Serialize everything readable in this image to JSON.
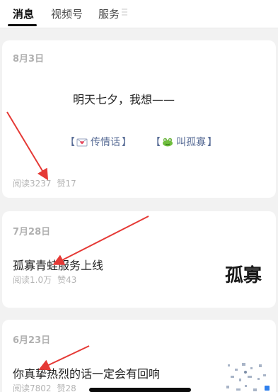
{
  "tabs": [
    {
      "label": "消息",
      "active": true
    },
    {
      "label": "视频号",
      "active": false
    },
    {
      "label": "服务",
      "active": false
    }
  ],
  "menu_icon": "menu-lines-icon",
  "cards": [
    {
      "date": "8月3日",
      "headline": "明天七夕，我想——",
      "links": [
        {
          "label": "传情话",
          "icon": "love-letter-icon",
          "prefix": "【",
          "suffix": "】"
        },
        {
          "label": "叫孤寡",
          "icon": "frog-icon",
          "prefix": "【",
          "suffix": "】"
        }
      ],
      "stats": {
        "reads": "阅读3237",
        "likes": "赞17"
      }
    },
    {
      "date": "7月28日",
      "headline": "孤寡青蛙服务上线",
      "thumb_text": "孤寡",
      "stats": {
        "reads": "阅读1.0万",
        "likes": "赞43"
      }
    },
    {
      "date": "6月23日",
      "headline": "你真挚热烈的话一定会有回响",
      "stats": {
        "reads": "阅读7802",
        "likes": "赞28"
      }
    }
  ],
  "colors": {
    "link": "#576b95",
    "annotation_arrow": "#e53935",
    "muted": "#b0b0b0"
  }
}
